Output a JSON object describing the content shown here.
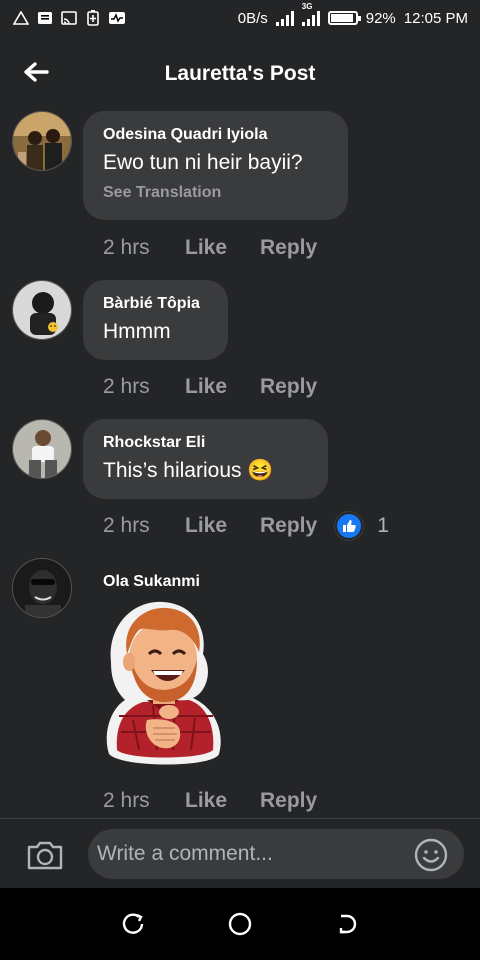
{
  "status_bar": {
    "speed": "0B/s",
    "network": "3G",
    "battery_percent": "92%",
    "battery_level": 0.92,
    "time": "12:05 PM",
    "left_icons": [
      "warning-triangle-icon",
      "notification-icon",
      "cast-icon",
      "battery-saver-icon",
      "activity-icon"
    ]
  },
  "header": {
    "title": "Lauretta's Post",
    "back_icon": "back-arrow-icon"
  },
  "comments": [
    {
      "author": "Odesina Quadri Iyiola",
      "text": "Ewo tun ni heir bayii?",
      "see_translation": "See Translation",
      "time": "2 hrs",
      "like_label": "Like",
      "reply_label": "Reply"
    },
    {
      "author": "Bàrbié Tôpia",
      "text": "Hmmm",
      "time": "2 hrs",
      "like_label": "Like",
      "reply_label": "Reply"
    },
    {
      "author": "Rhockstar Eli",
      "text": "This’s hilarious 😆",
      "time": "2 hrs",
      "like_label": "Like",
      "reply_label": "Reply",
      "reaction_icon": "like-reaction-icon",
      "reaction_count": "1"
    },
    {
      "author": "Ola Sukanmi",
      "sticker": "laughing-man-sticker",
      "time": "2 hrs",
      "like_label": "Like",
      "reply_label": "Reply"
    }
  ],
  "composer": {
    "placeholder": "Write a comment...",
    "camera_icon": "camera-icon",
    "emoji_icon": "emoji-icon"
  },
  "nav": {
    "icons": [
      "recent-apps-icon",
      "home-icon",
      "back-icon"
    ]
  },
  "colors": {
    "background": "#242527",
    "bubble": "#3a3b3c",
    "secondary_text": "#9a9b9e",
    "like_blue": "#1877f2"
  }
}
